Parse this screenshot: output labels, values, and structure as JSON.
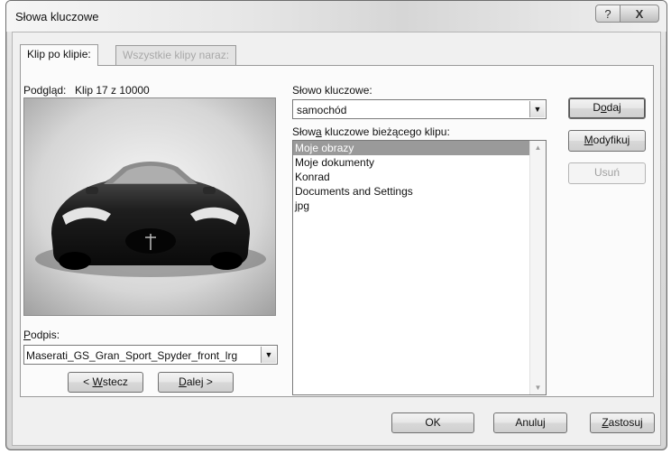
{
  "window": {
    "title": "Słowa kluczowe",
    "help_label": "?",
    "close_label": "X"
  },
  "tabs": [
    {
      "label": "Klip po klipie:",
      "active": true
    },
    {
      "label": "Wszystkie klipy naraz:",
      "active": false
    }
  ],
  "preview": {
    "label": "Podgląd:",
    "counter": "Klip 17 z 10000",
    "image": "car-photo"
  },
  "caption": {
    "label": "Podpis:",
    "value": "Maserati_GS_Gran_Sport_Spyder_front_lrg"
  },
  "nav": {
    "back_label": "< Wstecz",
    "next_label": "Dalej >"
  },
  "keyword": {
    "label": "Słowo kluczowe:",
    "value": "samochód"
  },
  "current_keywords": {
    "label": "Słowa kluczowe bieżącego klipu:",
    "items": [
      "Moje obrazy",
      "Moje dokumenty",
      "Konrad",
      "Documents and Settings",
      "jpg"
    ],
    "selected_index": 0
  },
  "side_buttons": {
    "add": "Dodaj",
    "modify": "Modyfikuj",
    "remove": "Usuń"
  },
  "footer": {
    "ok": "OK",
    "cancel": "Anuluj",
    "apply": "Zastosuj"
  }
}
